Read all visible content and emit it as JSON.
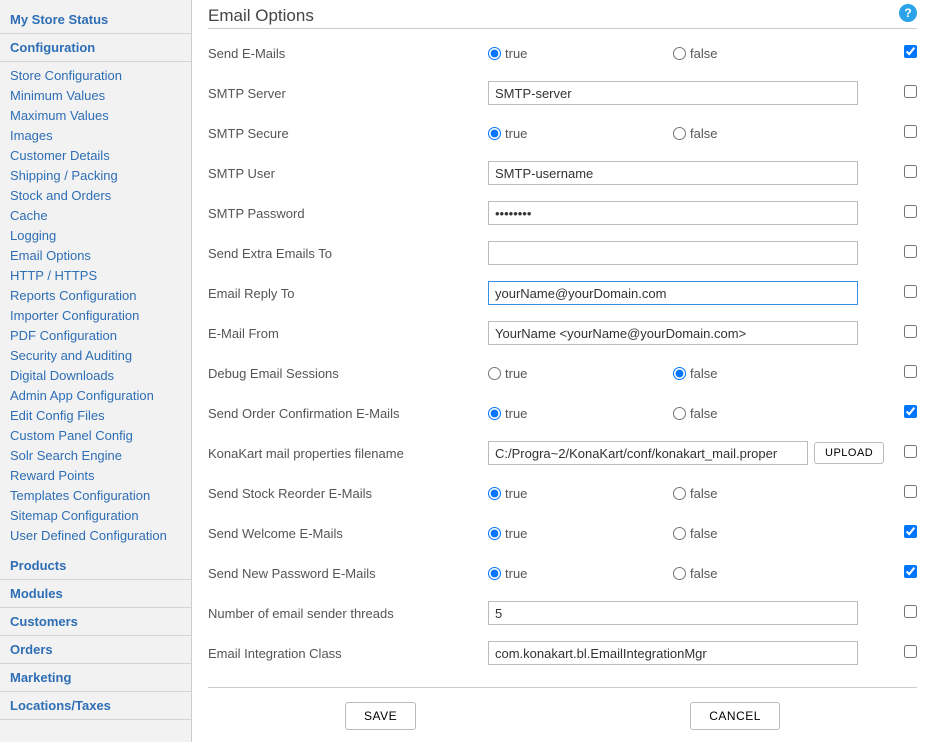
{
  "sidebar": {
    "sections": [
      {
        "label": "My Store Status",
        "items": []
      },
      {
        "label": "Configuration",
        "items": [
          "Store Configuration",
          "Minimum Values",
          "Maximum Values",
          "Images",
          "Customer Details",
          "Shipping / Packing",
          "Stock and Orders",
          "Cache",
          "Logging",
          "Email Options",
          "HTTP / HTTPS",
          "Reports Configuration",
          "Importer Configuration",
          "PDF Configuration",
          "Security and Auditing",
          "Digital Downloads",
          "Admin App Configuration",
          "Edit Config Files",
          "Custom Panel Config",
          "Solr Search Engine",
          "Reward Points",
          "Templates Configuration",
          "Sitemap Configuration",
          "User Defined Configuration"
        ]
      },
      {
        "label": "Products",
        "items": []
      },
      {
        "label": "Modules",
        "items": []
      },
      {
        "label": "Customers",
        "items": []
      },
      {
        "label": "Orders",
        "items": []
      },
      {
        "label": "Marketing",
        "items": []
      },
      {
        "label": "Locations/Taxes",
        "items": []
      }
    ]
  },
  "page": {
    "title": "Email Options",
    "help_glyph": "?"
  },
  "radio_labels": {
    "true": "true",
    "false": "false"
  },
  "fields": {
    "send_emails": {
      "label": "Send E-Mails",
      "type": "radio",
      "value": "true",
      "checked": true
    },
    "smtp_server": {
      "label": "SMTP Server",
      "type": "text",
      "value": "SMTP-server",
      "checked": false
    },
    "smtp_secure": {
      "label": "SMTP Secure",
      "type": "radio",
      "value": "true",
      "checked": false
    },
    "smtp_user": {
      "label": "SMTP User",
      "type": "text",
      "value": "SMTP-username",
      "checked": false
    },
    "smtp_password": {
      "label": "SMTP Password",
      "type": "password",
      "value": "••••••••",
      "checked": false
    },
    "send_extra_to": {
      "label": "Send Extra Emails To",
      "type": "text",
      "value": "",
      "checked": false
    },
    "reply_to": {
      "label": "Email Reply To",
      "type": "text",
      "value": "yourName@yourDomain.com",
      "focused": true,
      "checked": false
    },
    "email_from": {
      "label": "E-Mail From",
      "type": "text",
      "value": "YourName <yourName@yourDomain.com>",
      "checked": false
    },
    "debug_sessions": {
      "label": "Debug Email Sessions",
      "type": "radio",
      "value": "false",
      "checked": false
    },
    "order_conf": {
      "label": "Send Order Confirmation E-Mails",
      "type": "radio",
      "value": "true",
      "checked": true
    },
    "mail_props": {
      "label": "KonaKart mail properties filename",
      "type": "upload",
      "value": "C:/Progra~2/KonaKart/conf/konakart_mail.proper",
      "upload_label": "UPLOAD",
      "checked": false
    },
    "stock_reorder": {
      "label": "Send Stock Reorder E-Mails",
      "type": "radio",
      "value": "true",
      "checked": false
    },
    "welcome": {
      "label": "Send Welcome E-Mails",
      "type": "radio",
      "value": "true",
      "checked": true
    },
    "new_password": {
      "label": "Send New Password E-Mails",
      "type": "radio",
      "value": "true",
      "checked": true
    },
    "sender_threads": {
      "label": "Number of email sender threads",
      "type": "text",
      "value": "5",
      "checked": false
    },
    "integration_cls": {
      "label": "Email Integration Class",
      "type": "text",
      "value": "com.konakart.bl.EmailIntegrationMgr",
      "checked": false
    }
  },
  "field_order": [
    "send_emails",
    "smtp_server",
    "smtp_secure",
    "smtp_user",
    "smtp_password",
    "send_extra_to",
    "reply_to",
    "email_from",
    "debug_sessions",
    "order_conf",
    "mail_props",
    "stock_reorder",
    "welcome",
    "new_password",
    "sender_threads",
    "integration_cls"
  ],
  "buttons": {
    "save": "SAVE",
    "cancel": "CANCEL"
  }
}
